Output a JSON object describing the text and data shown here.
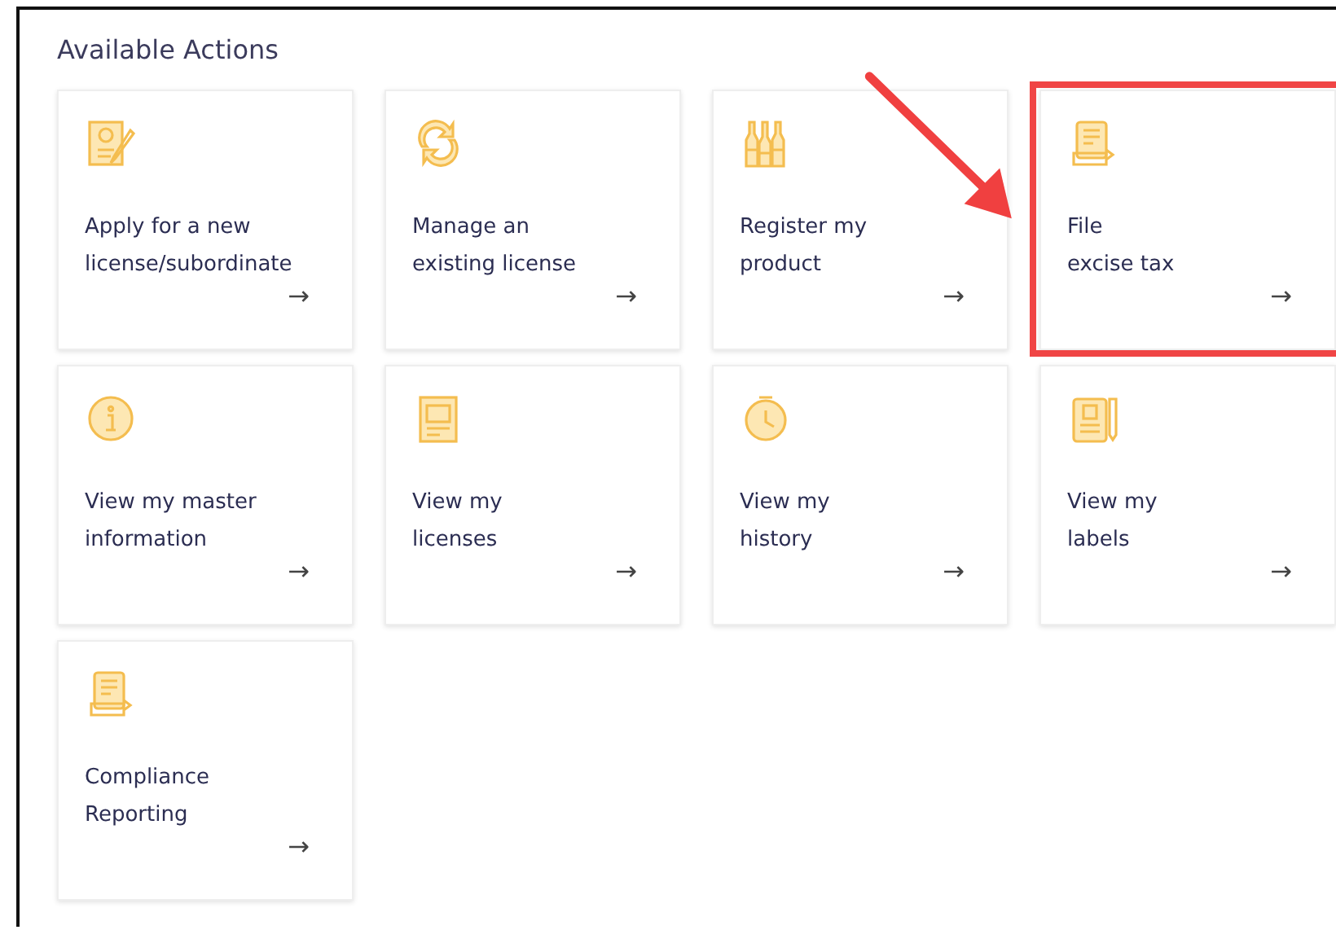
{
  "section": {
    "title": "Available Actions"
  },
  "actions": [
    {
      "kind": "certificate",
      "lines": [
        "Apply for a new",
        "license/subordinate"
      ],
      "arrow": "→",
      "highlighted": false
    },
    {
      "kind": "refresh",
      "lines": [
        "Manage an",
        "existing license"
      ],
      "arrow": "→",
      "highlighted": false
    },
    {
      "kind": "bottles",
      "lines": [
        "Register my",
        "product"
      ],
      "arrow": "→",
      "highlighted": false
    },
    {
      "kind": "tax",
      "lines": [
        "File",
        "excise tax"
      ],
      "arrow": "→",
      "highlighted": true
    },
    {
      "kind": "info",
      "lines": [
        "View my master",
        "information"
      ],
      "arrow": "→",
      "highlighted": false
    },
    {
      "kind": "license",
      "lines": [
        "View my",
        "licenses"
      ],
      "arrow": "→",
      "highlighted": false
    },
    {
      "kind": "clock",
      "lines": [
        "View my",
        "history"
      ],
      "arrow": "→",
      "highlighted": false
    },
    {
      "kind": "label",
      "lines": [
        "View my",
        "labels"
      ],
      "arrow": "→",
      "highlighted": false
    },
    {
      "kind": "report",
      "lines": [
        "Compliance",
        "Reporting"
      ],
      "arrow": "→",
      "highlighted": false
    }
  ]
}
